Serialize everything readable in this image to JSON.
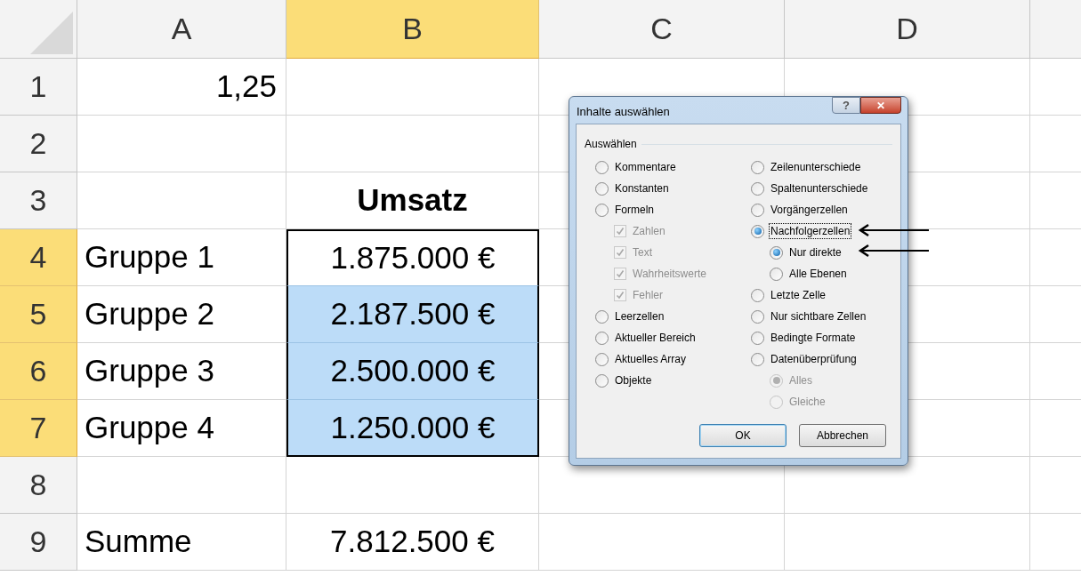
{
  "sheet": {
    "columns": [
      {
        "label": "A",
        "selected": false
      },
      {
        "label": "B",
        "selected": true
      },
      {
        "label": "C",
        "selected": false
      },
      {
        "label": "D",
        "selected": false
      }
    ],
    "rows": [
      {
        "label": "1",
        "selected": false,
        "cells": [
          {
            "text": "1,25",
            "kind": "number",
            "selected": false,
            "highlighted": false
          },
          {
            "kind": "empty",
            "selected": false,
            "highlighted": false
          }
        ]
      },
      {
        "label": "2",
        "selected": false,
        "cells": [
          {
            "kind": "empty",
            "selected": false,
            "highlighted": false
          },
          {
            "kind": "empty",
            "selected": false,
            "highlighted": false
          }
        ]
      },
      {
        "label": "3",
        "selected": false,
        "cells": [
          {
            "kind": "empty",
            "selected": false,
            "highlighted": false
          },
          {
            "text": "Umsatz",
            "kind": "header",
            "selected": false,
            "highlighted": false
          }
        ]
      },
      {
        "label": "4",
        "selected": true,
        "cells": [
          {
            "text": "Gruppe 1",
            "kind": "text",
            "selected": false,
            "highlighted": false
          },
          {
            "text": "1.875.000 €",
            "kind": "value",
            "selected": true,
            "highlighted": false
          }
        ]
      },
      {
        "label": "5",
        "selected": true,
        "cells": [
          {
            "text": "Gruppe 2",
            "kind": "text",
            "selected": false,
            "highlighted": false
          },
          {
            "text": "2.187.500 €",
            "kind": "value",
            "selected": true,
            "highlighted": true
          }
        ]
      },
      {
        "label": "6",
        "selected": true,
        "cells": [
          {
            "text": "Gruppe 3",
            "kind": "text",
            "selected": false,
            "highlighted": false
          },
          {
            "text": "2.500.000 €",
            "kind": "value",
            "selected": true,
            "highlighted": true
          }
        ]
      },
      {
        "label": "7",
        "selected": true,
        "cells": [
          {
            "text": "Gruppe 4",
            "kind": "text",
            "selected": false,
            "highlighted": false
          },
          {
            "text": "1.250.000 €",
            "kind": "value",
            "selected": true,
            "highlighted": true
          }
        ]
      },
      {
        "label": "8",
        "selected": false,
        "cells": [
          {
            "kind": "empty",
            "selected": false,
            "highlighted": false
          },
          {
            "kind": "empty",
            "selected": false,
            "highlighted": false
          }
        ]
      },
      {
        "label": "9",
        "selected": false,
        "cells": [
          {
            "text": "Summe",
            "kind": "text",
            "selected": false,
            "highlighted": false
          },
          {
            "text": "7.812.500 €",
            "kind": "value",
            "selected": false,
            "highlighted": false
          }
        ]
      }
    ]
  },
  "dialog": {
    "title": "Inhalte auswählen",
    "help_button": "?",
    "close_button": "✕",
    "group_label": "Auswählen",
    "left_options": [
      {
        "label": "Kommentare",
        "kind": "radio",
        "checked": false,
        "disabled": false,
        "focused": false
      },
      {
        "label": "Konstanten",
        "kind": "radio",
        "checked": false,
        "disabled": false,
        "focused": false
      },
      {
        "label": "Formeln",
        "kind": "radio",
        "checked": false,
        "disabled": false,
        "focused": false,
        "children": [
          {
            "label": "Zahlen",
            "kind": "checkbox",
            "checked": true,
            "disabled": true,
            "focused": false
          },
          {
            "label": "Text",
            "kind": "checkbox",
            "checked": true,
            "disabled": true,
            "focused": false
          },
          {
            "label": "Wahrheitswerte",
            "kind": "checkbox",
            "checked": true,
            "disabled": true,
            "focused": false
          },
          {
            "label": "Fehler",
            "kind": "checkbox",
            "checked": true,
            "disabled": true,
            "focused": false
          }
        ]
      },
      {
        "label": "Leerzellen",
        "kind": "radio",
        "checked": false,
        "disabled": false,
        "focused": false
      },
      {
        "label": "Aktueller Bereich",
        "kind": "radio",
        "checked": false,
        "disabled": false,
        "focused": false
      },
      {
        "label": "Aktuelles Array",
        "kind": "radio",
        "checked": false,
        "disabled": false,
        "focused": false
      },
      {
        "label": "Objekte",
        "kind": "radio",
        "checked": false,
        "disabled": false,
        "focused": false
      }
    ],
    "right_options": [
      {
        "label": "Zeilenunterschiede",
        "kind": "radio",
        "checked": false,
        "disabled": false,
        "focused": false
      },
      {
        "label": "Spaltenunterschiede",
        "kind": "radio",
        "checked": false,
        "disabled": false,
        "focused": false
      },
      {
        "label": "Vorgängerzellen",
        "kind": "radio",
        "checked": false,
        "disabled": false,
        "focused": false
      },
      {
        "label": "Nachfolgerzellen",
        "kind": "radio",
        "checked": true,
        "disabled": false,
        "focused": true,
        "children": [
          {
            "label": "Nur direkte",
            "kind": "radio",
            "checked": true,
            "disabled": false,
            "focused": false
          },
          {
            "label": "Alle Ebenen",
            "kind": "radio",
            "checked": false,
            "disabled": false,
            "focused": false
          }
        ]
      },
      {
        "label": "Letzte Zelle",
        "kind": "radio",
        "checked": false,
        "disabled": false,
        "focused": false
      },
      {
        "label": "Nur sichtbare Zellen",
        "kind": "radio",
        "checked": false,
        "disabled": false,
        "focused": false
      },
      {
        "label": "Bedingte Formate",
        "kind": "radio",
        "checked": false,
        "disabled": false,
        "focused": false
      },
      {
        "label": "Datenüberprüfung",
        "kind": "radio",
        "checked": false,
        "disabled": false,
        "focused": false,
        "children": [
          {
            "label": "Alles",
            "kind": "radio",
            "checked": true,
            "disabled": true,
            "focused": false
          },
          {
            "label": "Gleiche",
            "kind": "radio",
            "checked": false,
            "disabled": true,
            "focused": false
          }
        ]
      }
    ],
    "buttons": [
      {
        "label": "OK",
        "default": true
      },
      {
        "label": "Abbrechen",
        "default": false
      }
    ]
  }
}
